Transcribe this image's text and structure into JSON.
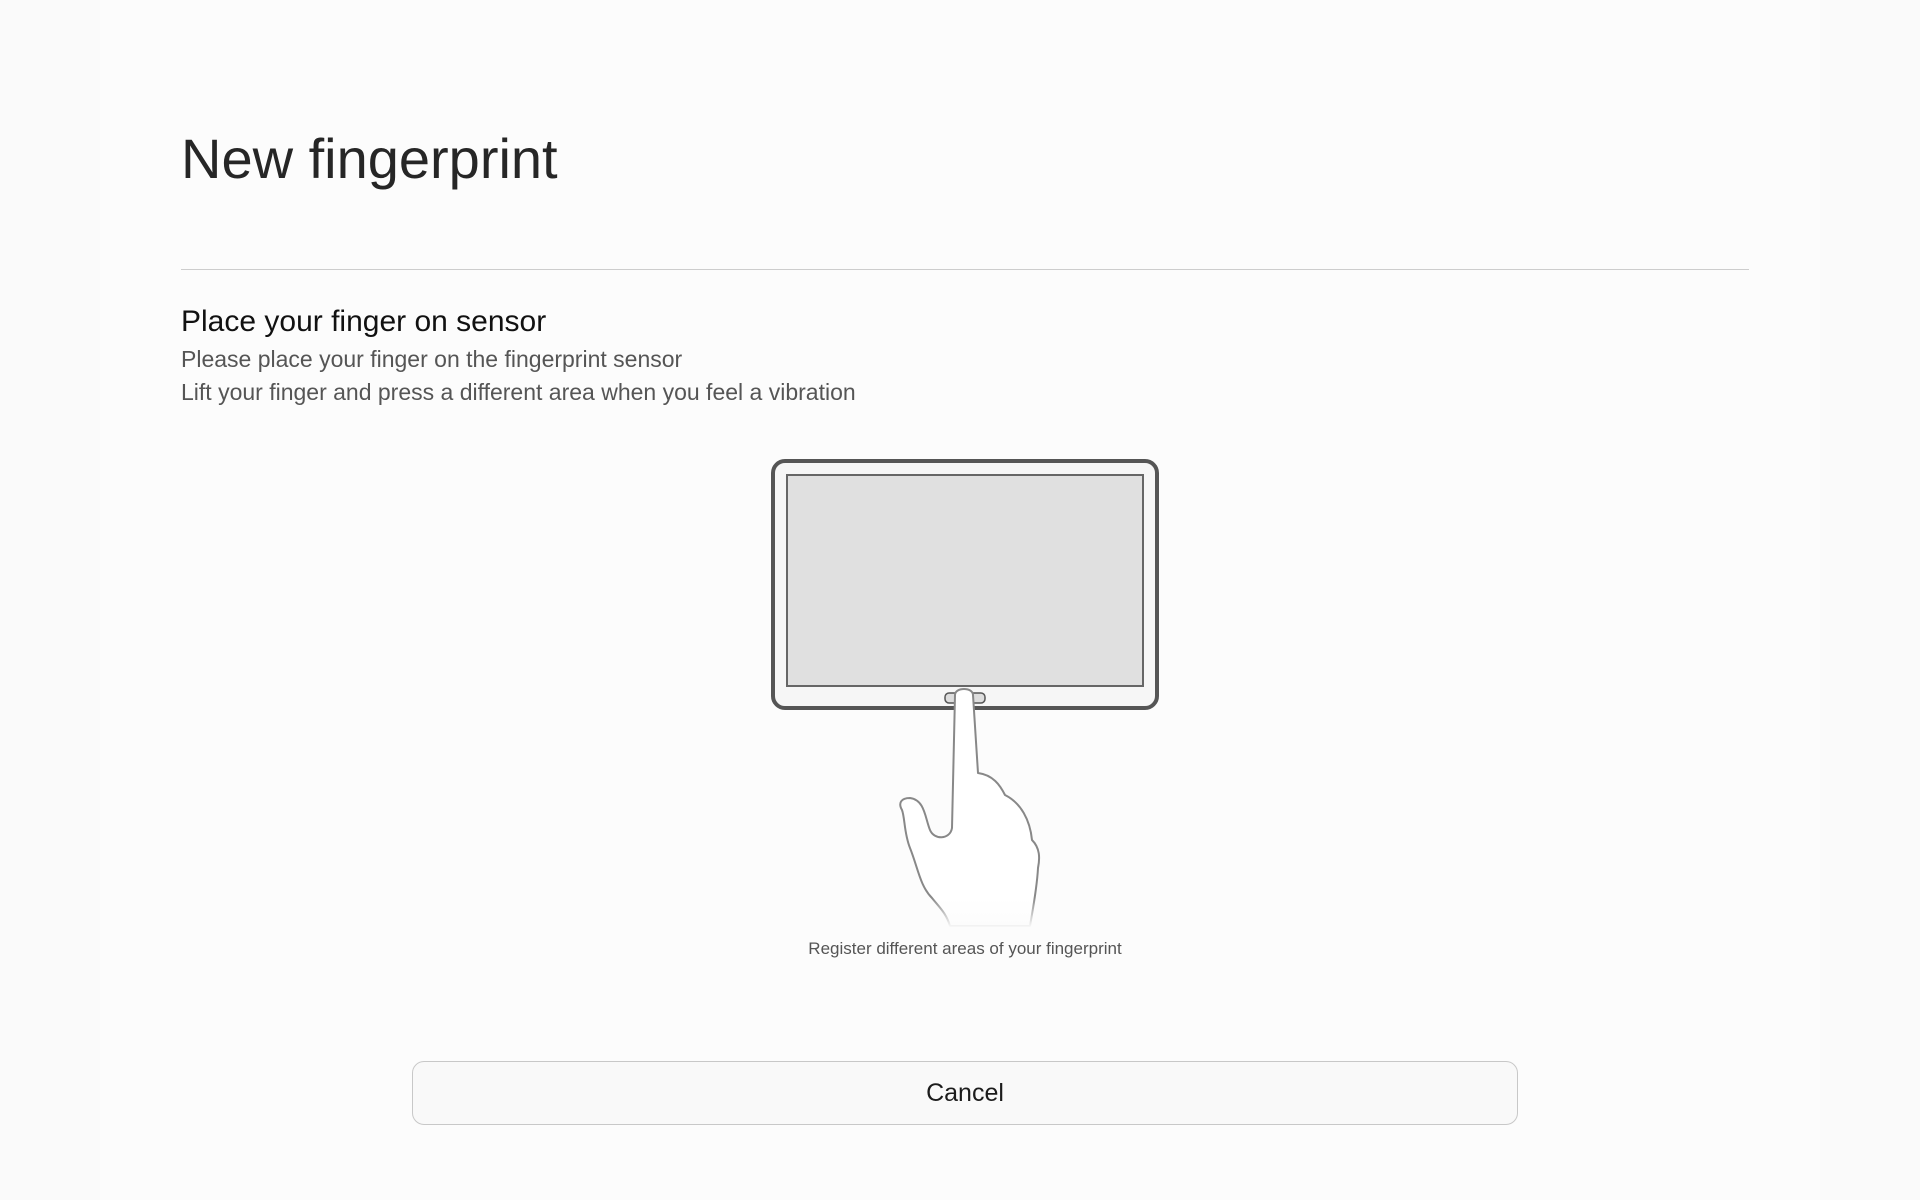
{
  "header": {
    "title": "New fingerprint"
  },
  "instructions": {
    "heading": "Place your finger on sensor",
    "line1": "Please place your finger on the fingerprint sensor",
    "line2": "Lift your finger and press a different area when you feel a vibration"
  },
  "illustration": {
    "icon": "tablet-finger-on-home-sensor-icon",
    "caption": "Register different areas of your fingerprint"
  },
  "actions": {
    "cancel_label": "Cancel"
  },
  "colors": {
    "background": "#fcfcfc",
    "title_text": "#262626",
    "body_text": "#555555",
    "divider": "#cdcdcd",
    "device_frame": "#555555",
    "device_screen": "#e0e0e0"
  }
}
